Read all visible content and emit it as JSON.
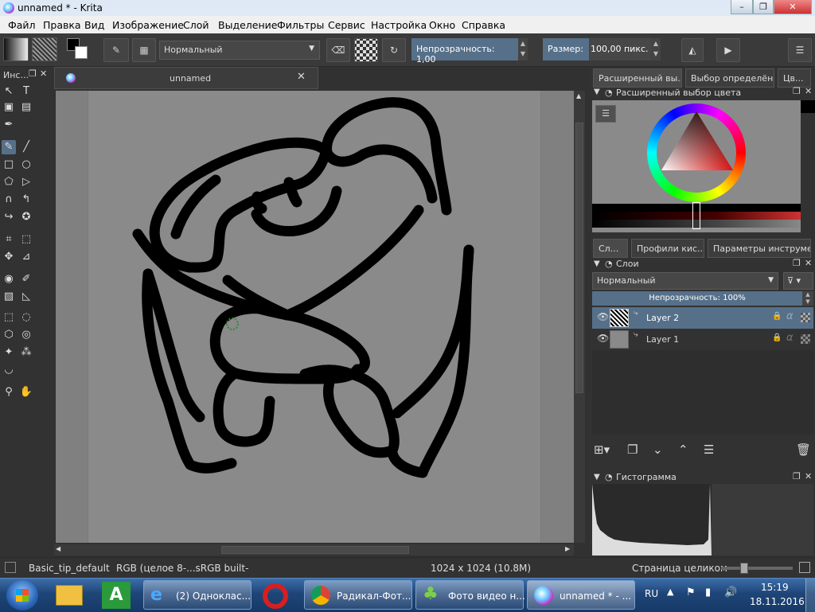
{
  "window": {
    "title": "unnamed * - Krita"
  },
  "menu": [
    "Файл",
    "Правка",
    "Вид",
    "Изображение",
    "Слой",
    "Выделение",
    "Фильтры",
    "Сервис",
    "Настройка",
    "Окно",
    "Справка"
  ],
  "toolbar": {
    "blend_mode": "Нормальный",
    "opacity_label": "Непрозрачность:",
    "opacity_value": "1,00",
    "size_label": "Размер:",
    "size_value": "100,00 пикс."
  },
  "toolbox": {
    "title": "Инс..."
  },
  "document": {
    "tab_title": "unnamed"
  },
  "right": {
    "tabs": [
      "Расширенный вы...",
      "Выбор определён...",
      "Цв..."
    ],
    "color_panel_title": "Расширенный выбор цвета",
    "mid_tabs": [
      "Сл...",
      "Профили кис...",
      "Параметры инструме..."
    ],
    "layers_title": "Слои",
    "layers_blend": "Нормальный",
    "layers_opacity_label": "Непрозрачность:",
    "layers_opacity_value": "100%",
    "layers": [
      {
        "name": "Layer 2"
      },
      {
        "name": "Layer 1"
      }
    ],
    "histogram_title": "Гистограмма"
  },
  "status": {
    "brush": "Basic_tip_default",
    "color_model": "RGB (целое 8-...sRGB built-",
    "dimensions": "1024 x 1024 (10.8M)",
    "zoom_mode": "Страница целиком"
  },
  "taskbar": {
    "apps": [
      {
        "label": "(2) Одноклас..."
      },
      {
        "label": "Радикал-Фот..."
      },
      {
        "label": "Фото видео н..."
      },
      {
        "label": "unnamed * - ..."
      }
    ],
    "lang": "RU",
    "time": "15:19",
    "date": "18.11.2016"
  }
}
